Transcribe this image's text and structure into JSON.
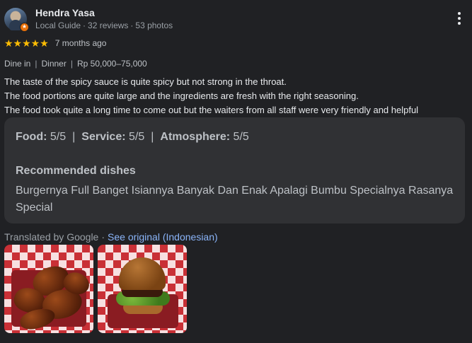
{
  "author": {
    "name": "Hendra Yasa",
    "level": "Local Guide",
    "reviews": "32 reviews",
    "photos": "53 photos",
    "meta_separator": "·"
  },
  "rating": {
    "stars": "★★★★★",
    "value": 5,
    "time": "7 months ago"
  },
  "tags": {
    "service": "Dine in",
    "meal": "Dinner",
    "price": "Rp 50,000–75,000",
    "divider": "|"
  },
  "review_lines": [
    "The taste of the spicy sauce is quite spicy but not strong in the throat.",
    "The food portions are quite large and the ingredients are fresh with the right seasoning.",
    "The food took quite a long time to come out but the waiters from all staff were very friendly and helpful"
  ],
  "card": {
    "food_label": "Food:",
    "food_value": "5/5",
    "service_label": "Service:",
    "service_value": "5/5",
    "atmosphere_label": "Atmosphere:",
    "atmosphere_value": "5/5",
    "divider": "|",
    "recommended_title": "Recommended dishes",
    "recommended_text": "Burgernya Full Banget Isiannya Banyak Dan Enak Apalagi Bumbu Specialnya Rasanya Special"
  },
  "translation": {
    "label": "Translated by Google",
    "dot": "·",
    "link": "See original (Indonesian)"
  },
  "photos": [
    {
      "icon": "chicken-wings-photo"
    },
    {
      "icon": "burger-photo"
    }
  ],
  "colors": {
    "background": "#202124",
    "card": "#303134",
    "star": "#fbbc04",
    "link": "#8ab4f8",
    "badge": "#e8710a"
  }
}
